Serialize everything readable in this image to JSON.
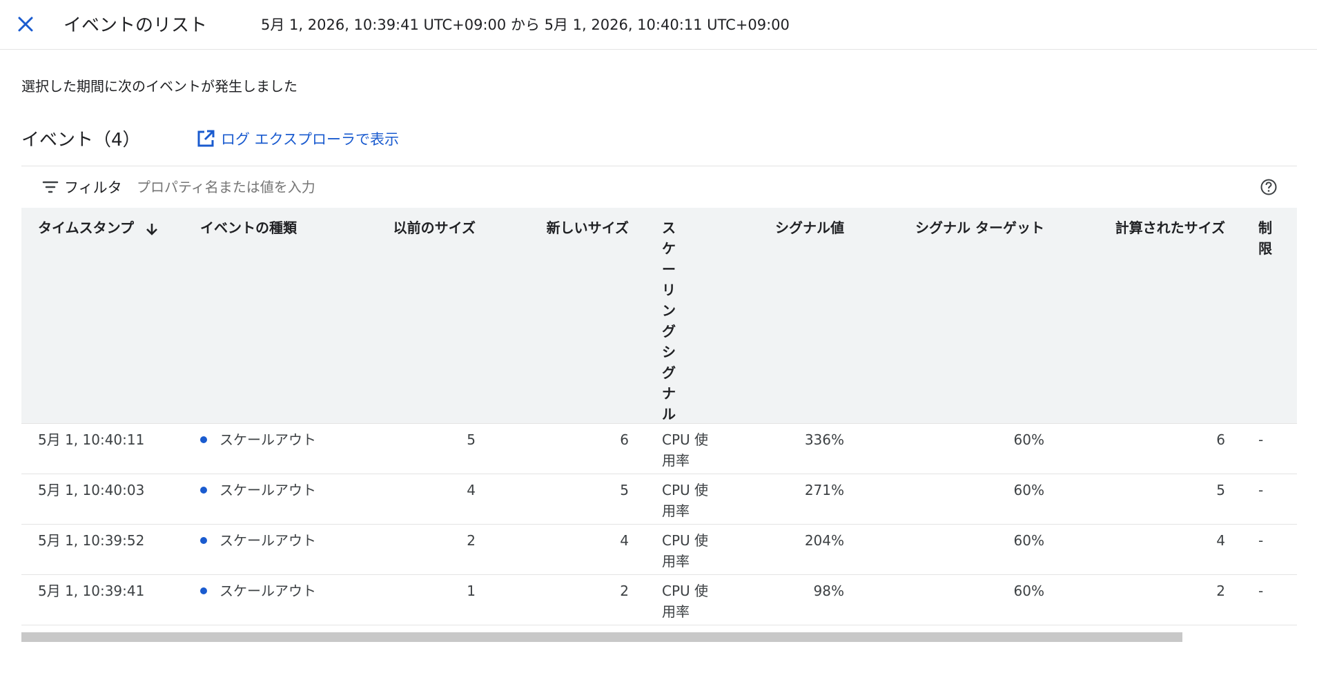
{
  "header": {
    "title": "イベントのリスト",
    "range": "5月 1, 2026, 10:39:41 UTC+09:00 から 5月 1, 2026, 10:40:11 UTC+09:00"
  },
  "subtitle": "選択した期間に次のイベントが発生しました",
  "events_title": "イベント（4）",
  "log_link": "ログ エクスプローラで表示",
  "filter": {
    "label": "フィルタ",
    "placeholder": "プロパティ名または値を入力"
  },
  "columns": {
    "timestamp": "タイムスタンプ",
    "event_type": "イベントの種類",
    "prev_size": "以前のサイズ",
    "new_size": "新しいサイズ",
    "signal": "スケーリングシグナル",
    "signal_value": "シグナル値",
    "signal_target": "シグナル ターゲット",
    "computed_size": "計算されたサイズ",
    "limit": "制限"
  },
  "rows": [
    {
      "timestamp": "5月 1, 10:40:11",
      "event_type": "スケールアウト",
      "prev_size": "5",
      "new_size": "6",
      "signal": "CPU 使用率",
      "signal_value": "336%",
      "signal_target": "60%",
      "computed_size": "6",
      "limit": "-"
    },
    {
      "timestamp": "5月 1, 10:40:03",
      "event_type": "スケールアウト",
      "prev_size": "4",
      "new_size": "5",
      "signal": "CPU 使用率",
      "signal_value": "271%",
      "signal_target": "60%",
      "computed_size": "5",
      "limit": "-"
    },
    {
      "timestamp": "5月 1, 10:39:52",
      "event_type": "スケールアウト",
      "prev_size": "2",
      "new_size": "4",
      "signal": "CPU 使用率",
      "signal_value": "204%",
      "signal_target": "60%",
      "computed_size": "4",
      "limit": "-"
    },
    {
      "timestamp": "5月 1, 10:39:41",
      "event_type": "スケールアウト",
      "prev_size": "1",
      "new_size": "2",
      "signal": "CPU 使用率",
      "signal_value": "98%",
      "signal_target": "60%",
      "computed_size": "2",
      "limit": "-"
    }
  ],
  "colors": {
    "accent": "#1a5bcf",
    "header_bg": "#f1f3f4",
    "dot": "#1a5bcf"
  },
  "icons": {
    "close": "close-icon",
    "open_in_new": "open-in-new-icon",
    "filter": "filter-icon",
    "help": "help-icon",
    "sort": "arrow-down-icon"
  }
}
